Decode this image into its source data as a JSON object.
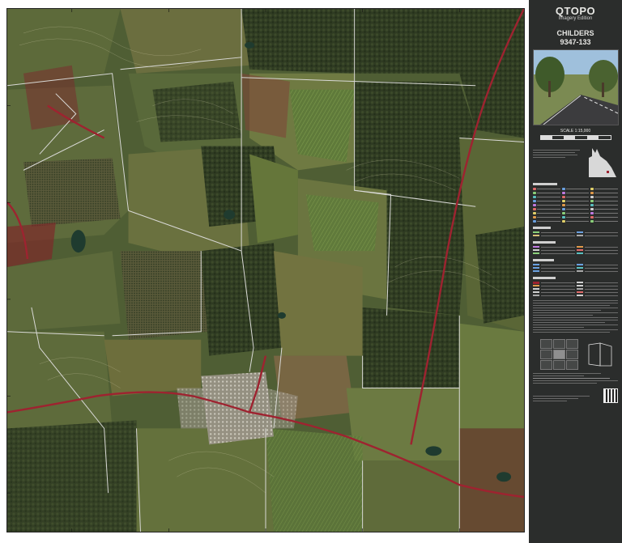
{
  "title": {
    "brand": "QTOPO",
    "edition": "Imagery Edition",
    "sheet_name": "CHILDERS",
    "sheet_number": "9347-133"
  },
  "scale": {
    "label": "SCALE 1:15,000"
  },
  "icons": {
    "road_photo": "road-photo",
    "locality_map": "queensland-outline-icon",
    "qr": "qr-code-icon"
  },
  "colors": {
    "map_background": "#4f5e34",
    "highway": "#9e2330",
    "road": "#d9d9d6",
    "panel": "#2b2d2c",
    "water": "#1f3b2f",
    "urban": "#b9b1a4"
  }
}
